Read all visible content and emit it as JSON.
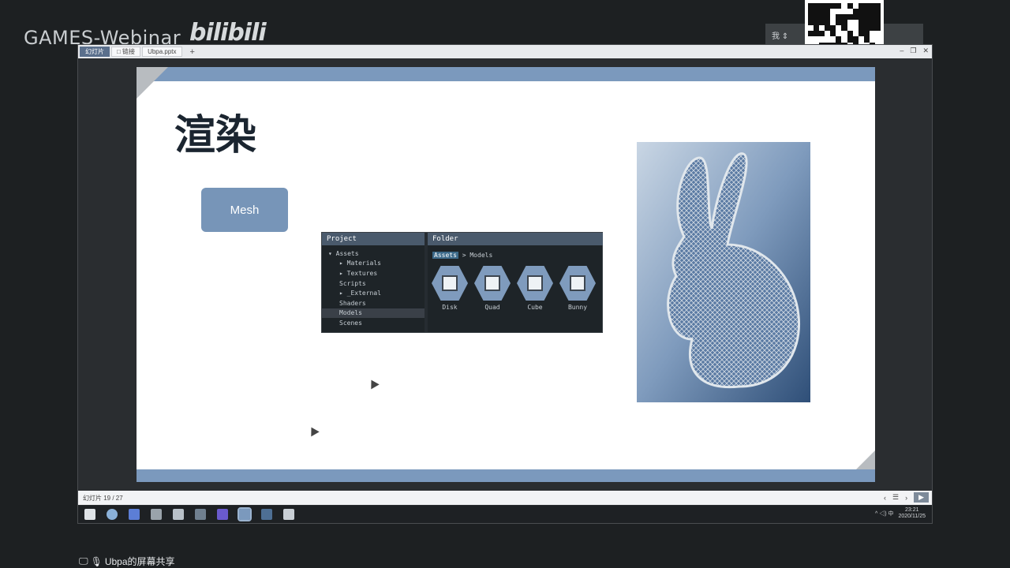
{
  "overlay": {
    "watermark": "GAMES-Webinar",
    "platform_logo": "bilibili",
    "share_label": "Ubpa的屏幕共享",
    "corner_label": "我 ⇕"
  },
  "browser": {
    "tabs": [
      {
        "label": "幻灯片",
        "active": true
      },
      {
        "label": "□ 链接",
        "active": false
      },
      {
        "label": "Ubpa.pptx",
        "active": false
      }
    ],
    "window_controls": [
      "–",
      "❐",
      "✕"
    ]
  },
  "slide": {
    "title": "渲染",
    "mesh_button": "Mesh",
    "project_panel": {
      "left_header": "Project",
      "right_header": "Folder",
      "tree": [
        {
          "label": "▾ Assets",
          "indent": 0
        },
        {
          "label": "▸ Materials",
          "indent": 1
        },
        {
          "label": "▸ Textures",
          "indent": 1
        },
        {
          "label": "Scripts",
          "indent": 1
        },
        {
          "label": "▸ _External",
          "indent": 1
        },
        {
          "label": "Shaders",
          "indent": 1
        },
        {
          "label": "Models",
          "indent": 1,
          "selected": true
        },
        {
          "label": "Scenes",
          "indent": 1
        }
      ],
      "breadcrumb_root": "Assets",
      "breadcrumb_tail": "> Models",
      "assets": [
        "Disk",
        "Quad",
        "Cube",
        "Bunny"
      ]
    }
  },
  "statusbar": {
    "page_info": "幻灯片 19 / 27",
    "controls": [
      "‹",
      "☰",
      "›"
    ],
    "zoom": "▶"
  },
  "taskbar": {
    "time": "23:21",
    "date": "2020/11/25",
    "tray": "^ ◁) 中"
  },
  "colors": {
    "slide_accent": "#7b99bd",
    "mesh_button": "#7795b8",
    "panel_bg": "#1e2428"
  }
}
